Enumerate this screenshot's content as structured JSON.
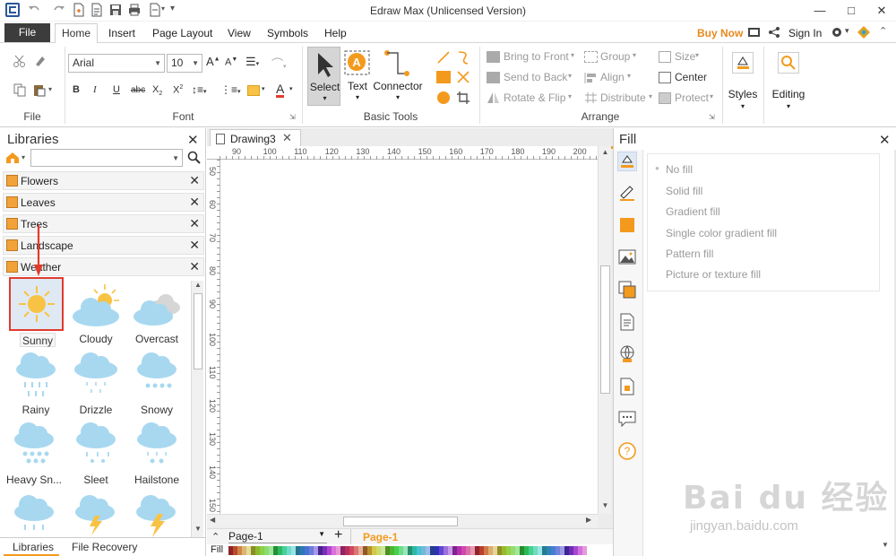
{
  "window": {
    "title": "Edraw Max (Unlicensed Version)",
    "minimize": "—",
    "maximize": "□",
    "close": "✕"
  },
  "menu": {
    "file": "File",
    "home": "Home",
    "insert": "Insert",
    "page_layout": "Page Layout",
    "view": "View",
    "symbols": "Symbols",
    "help": "Help",
    "buy_now": "Buy Now",
    "sign_in": "Sign In"
  },
  "ribbon": {
    "groups": {
      "file": "File",
      "font": "Font",
      "basic_tools": "Basic Tools",
      "arrange": "Arrange"
    },
    "font_name": "Arial",
    "font_size": "10",
    "tools": {
      "select": "Select",
      "text": "Text",
      "connector": "Connector"
    },
    "arrange": {
      "bring_to_front": "Bring to Front",
      "send_to_back": "Send to Back",
      "rotate_flip": "Rotate & Flip",
      "group": "Group",
      "align": "Align",
      "distribute": "Distribute",
      "size": "Size",
      "center": "Center",
      "protect": "Protect"
    },
    "styles": "Styles",
    "editing": "Editing"
  },
  "libraries": {
    "title": "Libraries",
    "search_value": "",
    "categories": [
      "Flowers",
      "Leaves",
      "Trees",
      "Landscape",
      "Weather"
    ],
    "shapes": [
      {
        "label": "Sunny",
        "icon": "sunny-icon"
      },
      {
        "label": "Cloudy",
        "icon": "cloudy-icon"
      },
      {
        "label": "Overcast",
        "icon": "overcast-icon"
      },
      {
        "label": "Rainy",
        "icon": "rainy-icon"
      },
      {
        "label": "Drizzle",
        "icon": "drizzle-icon"
      },
      {
        "label": "Snowy",
        "icon": "snowy-icon"
      },
      {
        "label": "Heavy Sn...",
        "icon": "heavy-snow-icon"
      },
      {
        "label": "Sleet",
        "icon": "sleet-icon"
      },
      {
        "label": "Hailstone",
        "icon": "hailstone-icon"
      }
    ],
    "bottom_tabs": [
      "Libraries",
      "File Recovery"
    ]
  },
  "document": {
    "tab": "Drawing3",
    "ruler_h": [
      "90",
      "100",
      "110",
      "120",
      "130",
      "140",
      "150",
      "160",
      "170",
      "180",
      "190",
      "200"
    ],
    "ruler_v": [
      "50",
      "60",
      "70",
      "80",
      "90",
      "100",
      "110",
      "120",
      "130",
      "140",
      "150"
    ],
    "page_selector": "Page-1",
    "active_page": "Page-1",
    "fill_label": "Fill"
  },
  "fill_panel": {
    "title": "Fill",
    "options": [
      "No fill",
      "Solid fill",
      "Gradient fill",
      "Single color gradient fill",
      "Pattern fill",
      "Picture or texture fill"
    ]
  },
  "watermark": {
    "line1": "Bai du 经验",
    "line2": "jingyan.baidu.com"
  },
  "colors": {
    "accent_orange": "#f39a1e",
    "sun_yellow": "#f8c244",
    "cloud_blue": "#a8d8f0",
    "highlight_red": "#e23b2e"
  }
}
